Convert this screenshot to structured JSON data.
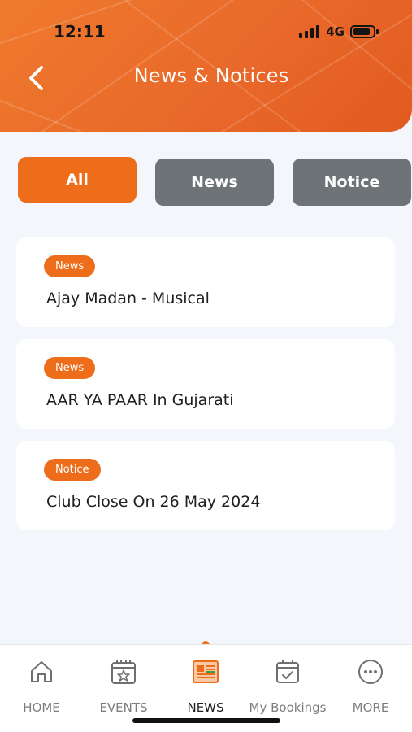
{
  "status_bar": {
    "time": "12:11",
    "network": "4G"
  },
  "header": {
    "title": "News & Notices"
  },
  "filters": [
    {
      "label": "All",
      "active": true
    },
    {
      "label": "News",
      "active": false
    },
    {
      "label": "Notice",
      "active": false
    }
  ],
  "items": [
    {
      "tag": "News",
      "title": "Ajay Madan - Musical"
    },
    {
      "tag": "News",
      "title": "AAR YA PAAR In Gujarati"
    },
    {
      "tag": "Notice",
      "title": "Club Close On 26 May 2024"
    }
  ],
  "tabs": [
    {
      "label": "HOME",
      "icon": "home-icon"
    },
    {
      "label": "EVENTS",
      "icon": "calendar-star-icon"
    },
    {
      "label": "NEWS",
      "icon": "newspaper-icon",
      "active": true
    },
    {
      "label": "My Bookings",
      "icon": "calendar-check-icon"
    },
    {
      "label": "MORE",
      "icon": "more-icon"
    }
  ],
  "colors": {
    "accent": "#ee6d1a",
    "inactive_filter": "#6e7378",
    "background": "#f3f6fa"
  }
}
